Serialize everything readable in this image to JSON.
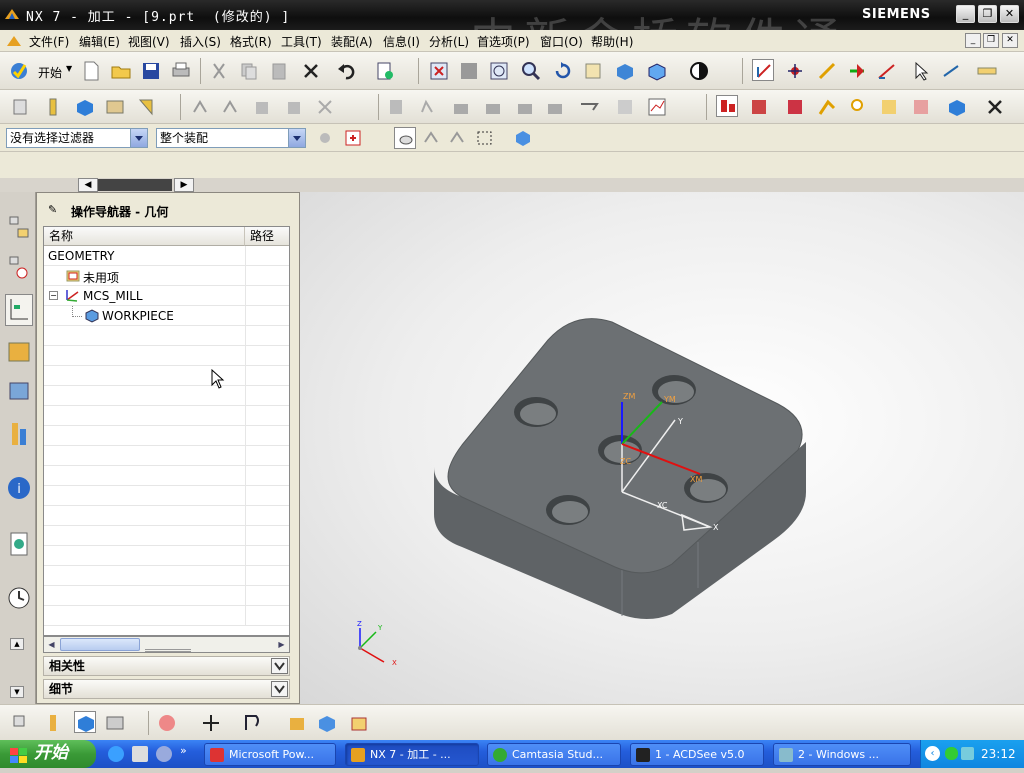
{
  "window": {
    "title": "NX 7 - 加工 - [9.prt  (修改的) ]",
    "brand": "SIEMENS"
  },
  "watermark": "中新金桥软件通",
  "menu": [
    "文件(F)",
    "编辑(E)",
    "视图(V)",
    "插入(S)",
    "格式(R)",
    "工具(T)",
    "装配(A)",
    "信息(I)",
    "分析(L)",
    "首选项(P)",
    "窗口(O)",
    "帮助(H)"
  ],
  "toolbar": {
    "start_label": "开始"
  },
  "filters": {
    "selection_filter": "没有选择过滤器",
    "assembly_scope": "整个装配"
  },
  "navigator": {
    "title": "操作导航器 - 几何",
    "columns": [
      "名称",
      "路径"
    ],
    "rows": [
      {
        "label": "GEOMETRY",
        "icon": "none"
      },
      {
        "label": "未用项",
        "icon": "folder-icon"
      },
      {
        "label": "MCS_MILL",
        "icon": "mcs-axes-icon"
      },
      {
        "label": "WORKPIECE",
        "icon": "workpiece-icon"
      }
    ],
    "sections": [
      "相关性",
      "细节"
    ]
  },
  "model_labels": {
    "zm": "ZM",
    "ym": "YM",
    "xm": "XM",
    "zc": "ZC",
    "yc": "Y",
    "xc": "XC",
    "x": "X",
    "axis_x": "X",
    "axis_y": "Y",
    "axis_z": "Z"
  },
  "taskbar": {
    "start": "开始",
    "tasks": [
      "Microsoft Pow...",
      "NX 7 - 加工 - ...",
      "Camtasia Stud...",
      "1 - ACDSee v5.0",
      "2 - Windows ..."
    ],
    "time": "23:12"
  },
  "colors": {
    "model_gray": "#6b6f72",
    "taskbar_blue": "#245edc",
    "start_green": "#3a9a37"
  }
}
